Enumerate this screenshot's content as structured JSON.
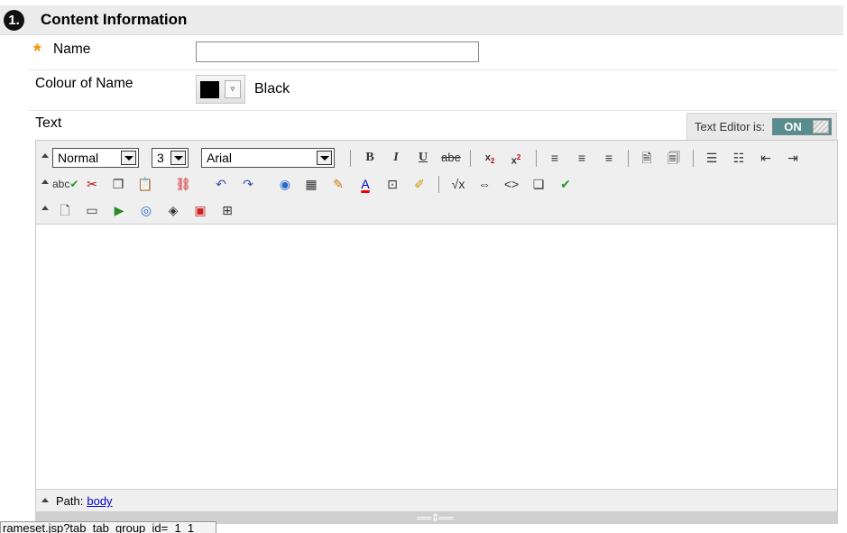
{
  "section": {
    "step": "1.",
    "title": "Content Information"
  },
  "form": {
    "name_label": "Name",
    "name_value": "",
    "colour_label": "Colour of Name",
    "colour_value": "Black",
    "colour_hex": "#000000",
    "text_label": "Text"
  },
  "editor_toggle": {
    "label": "Text Editor is:",
    "state": "ON"
  },
  "toolbar": {
    "format_select": "Normal",
    "size_select": "3",
    "font_select": "Arial",
    "row1_icons": [
      "bold-icon",
      "italic-icon",
      "underline-icon",
      "strikethrough-icon",
      "subscript-icon",
      "superscript-icon",
      "align-left-icon",
      "align-center-icon",
      "align-right-icon",
      "paste-text-icon",
      "paste-word-icon",
      "ordered-list-icon",
      "unordered-list-icon",
      "outdent-icon",
      "indent-icon"
    ],
    "row2_icons": [
      "spellcheck-icon",
      "cut-icon",
      "copy-icon",
      "paste-icon",
      "unlink-icon",
      "undo-icon",
      "redo-icon",
      "insert-link-icon",
      "table-icon",
      "highlight-pen-icon",
      "text-color-icon",
      "insert-symbol-icon",
      "background-color-icon",
      "math-icon",
      "html-icon",
      "code-icon",
      "preview-icon",
      "check-icon"
    ],
    "row3_icons": [
      "insert-file-icon",
      "insert-image-icon",
      "insert-media-icon",
      "mashup-icon",
      "insert-flash-icon",
      "insert-pdf-icon",
      "insert-table-icon"
    ]
  },
  "path_bar": {
    "label": "Path:",
    "link": "body"
  },
  "status_tip": "rameset.jsp?tab_tab_group_id=_1_1"
}
